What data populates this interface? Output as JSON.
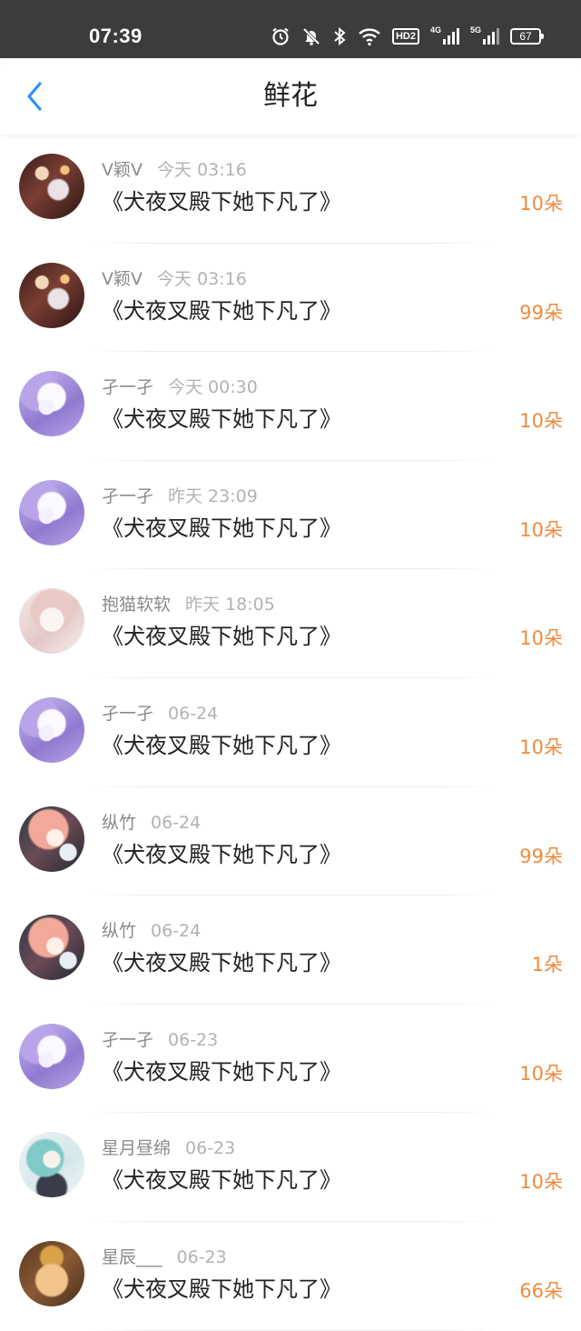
{
  "status_bar": {
    "time": "07:39",
    "hd_label": "HD2",
    "net1": "4G",
    "net2": "5G",
    "battery": "67"
  },
  "header": {
    "title": "鲜花"
  },
  "colors": {
    "accent_orange": "#f08a3c",
    "back_blue": "#2f8ff0"
  },
  "items": [
    {
      "user": "V颖V",
      "time": "今天 03:16",
      "book": "《犬夜叉殿下她下凡了》",
      "amount": "10朵",
      "avatar": "avatar-dark-photo"
    },
    {
      "user": "V颖V",
      "time": "今天 03:16",
      "book": "《犬夜叉殿下她下凡了》",
      "amount": "99朵",
      "avatar": "avatar-dark-photo"
    },
    {
      "user": "孑一孑",
      "time": "今天 00:30",
      "book": "《犬夜叉殿下她下凡了》",
      "amount": "10朵",
      "avatar": "avatar-purple-anime"
    },
    {
      "user": "孑一孑",
      "time": "昨天 23:09",
      "book": "《犬夜叉殿下她下凡了》",
      "amount": "10朵",
      "avatar": "avatar-purple-anime"
    },
    {
      "user": "抱猫软软",
      "time": "昨天 18:05",
      "book": "《犬夜叉殿下她下凡了》",
      "amount": "10朵",
      "avatar": "avatar-pale-sketch"
    },
    {
      "user": "孑一孑",
      "time": "06-24",
      "book": "《犬夜叉殿下她下凡了》",
      "amount": "10朵",
      "avatar": "avatar-purple-anime"
    },
    {
      "user": "纵竹",
      "time": "06-24",
      "book": "《犬夜叉殿下她下凡了》",
      "amount": "99朵",
      "avatar": "avatar-pink-anime"
    },
    {
      "user": "纵竹",
      "time": "06-24",
      "book": "《犬夜叉殿下她下凡了》",
      "amount": "1朵",
      "avatar": "avatar-pink-anime"
    },
    {
      "user": "孑一孑",
      "time": "06-23",
      "book": "《犬夜叉殿下她下凡了》",
      "amount": "10朵",
      "avatar": "avatar-purple-anime"
    },
    {
      "user": "星月昼绵",
      "time": "06-23",
      "book": "《犬夜叉殿下她下凡了》",
      "amount": "10朵",
      "avatar": "avatar-teal-anime"
    },
    {
      "user": "星辰___",
      "time": "06-23",
      "book": "《犬夜叉殿下她下凡了》",
      "amount": "66朵",
      "avatar": "avatar-cat"
    }
  ]
}
